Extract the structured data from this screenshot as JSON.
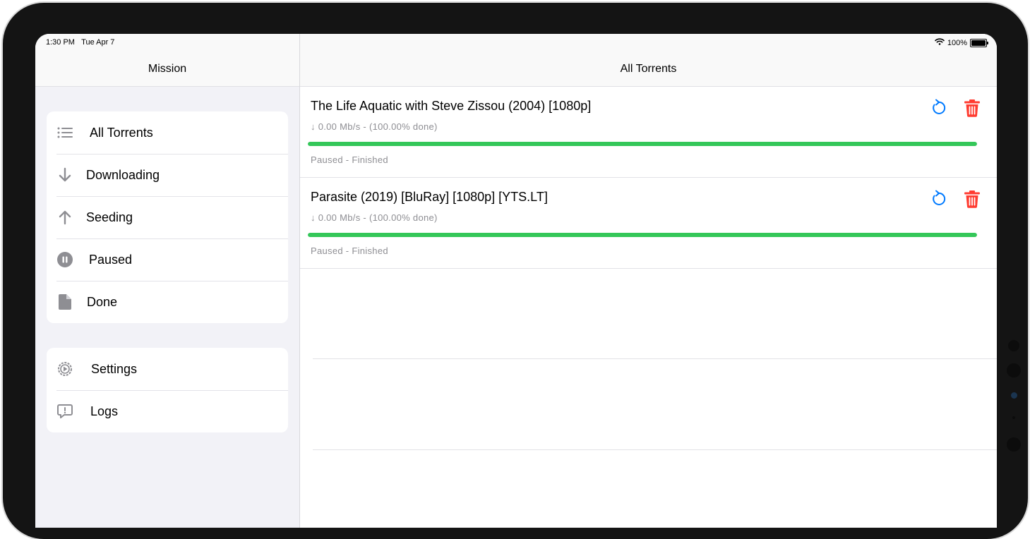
{
  "status_bar": {
    "time": "1:30 PM",
    "date": "Tue Apr 7",
    "wifi_icon": "wifi-icon",
    "battery": "100%"
  },
  "sidebar": {
    "title": "Mission",
    "groups": [
      {
        "items": [
          {
            "label": "All Torrents",
            "icon": "list-icon"
          },
          {
            "label": "Downloading",
            "icon": "arrow-down-icon"
          },
          {
            "label": "Seeding",
            "icon": "arrow-up-icon"
          },
          {
            "label": "Paused",
            "icon": "pause-circle-icon"
          },
          {
            "label": "Done",
            "icon": "document-icon"
          }
        ]
      },
      {
        "items": [
          {
            "label": "Settings",
            "icon": "gear-icon"
          },
          {
            "label": "Logs",
            "icon": "alert-bubble-icon"
          }
        ]
      }
    ]
  },
  "main": {
    "title": "All Torrents",
    "torrents": [
      {
        "name": "The Life Aquatic with Steve Zissou (2004) [1080p]",
        "speed": "↓ 0.00 Mb/s  - (100.00% done)",
        "progress": 1.0,
        "status": "Paused - Finished"
      },
      {
        "name": "Parasite (2019) [BluRay] [1080p] [YTS.LT]",
        "speed": "↓ 0.00 Mb/s  - (100.00% done)",
        "progress": 1.0,
        "status": "Paused - Finished"
      }
    ]
  },
  "colors": {
    "progress": "#34c759",
    "accent": "#007aff",
    "delete": "#ff3b30",
    "icon_gray": "#8e8e93"
  }
}
